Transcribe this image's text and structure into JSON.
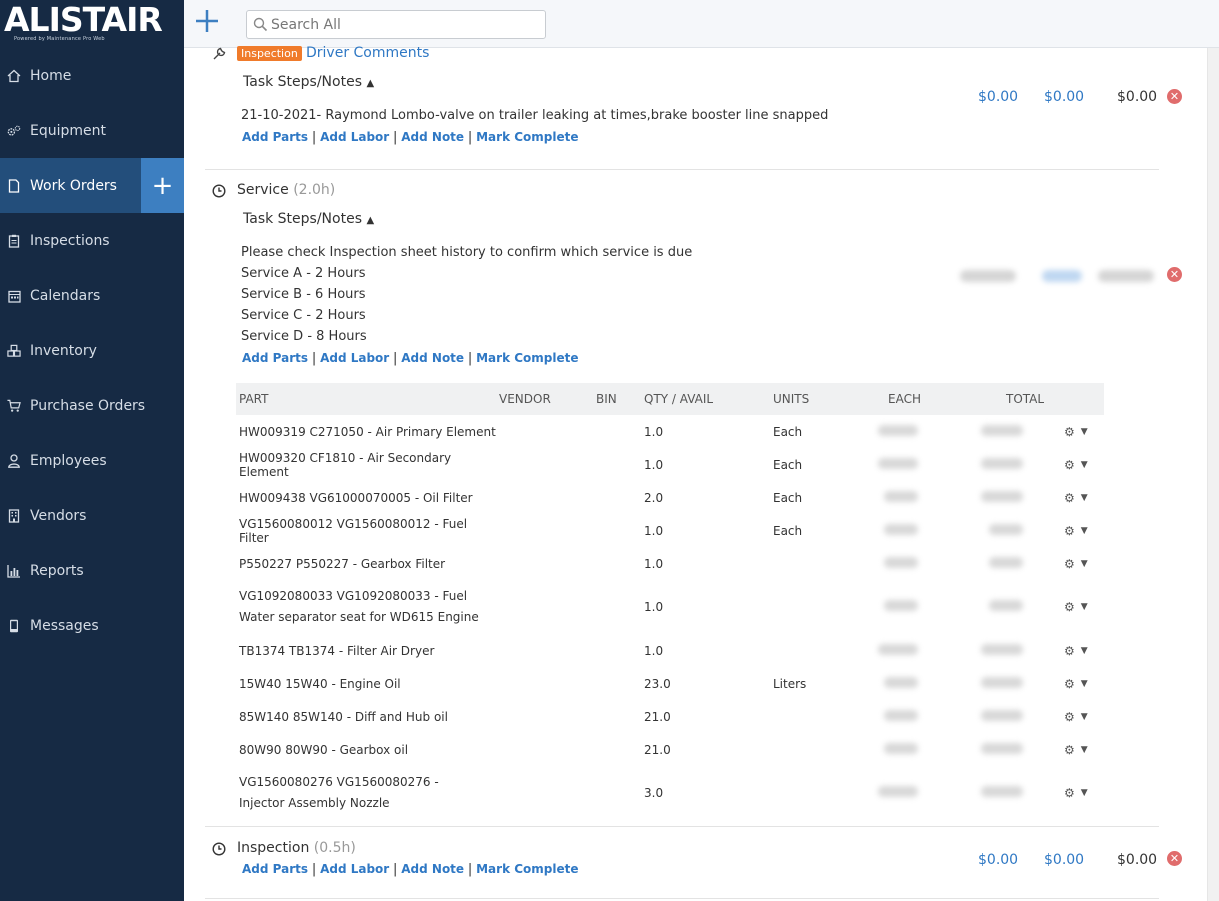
{
  "brand": {
    "logo_text": "ALISTAIR",
    "logo_sub": "Powered by Maintenance Pro Web"
  },
  "topbar": {
    "search_placeholder": "Search All"
  },
  "sidebar": {
    "items": [
      {
        "label": "Home",
        "icon": "home-icon"
      },
      {
        "label": "Equipment",
        "icon": "gears-icon"
      },
      {
        "label": "Work Orders",
        "icon": "document-icon",
        "active": true
      },
      {
        "label": "Inspections",
        "icon": "clipboard-icon"
      },
      {
        "label": "Calendars",
        "icon": "calendar-icon"
      },
      {
        "label": "Inventory",
        "icon": "cubes-icon"
      },
      {
        "label": "Purchase Orders",
        "icon": "cart-icon"
      },
      {
        "label": "Employees",
        "icon": "user-icon"
      },
      {
        "label": "Vendors",
        "icon": "building-icon"
      },
      {
        "label": "Reports",
        "icon": "chart-icon"
      },
      {
        "label": "Messages",
        "icon": "phone-icon"
      }
    ]
  },
  "actions": {
    "add_parts": "Add Parts",
    "add_labor": "Add Labor",
    "add_note": "Add Note",
    "mark_complete": "Mark Complete",
    "separator": "|"
  },
  "task_steps_label": "Task Steps/Notes",
  "task1": {
    "badge": "Inspection",
    "title": "Driver Comments",
    "note": "21-10-2021- Raymond Lombo-valve on trailer leaking at times,brake booster line snapped",
    "amount_parts": "$0.00",
    "amount_labor": "$0.00",
    "amount_total": "$0.00"
  },
  "task2": {
    "title": "Service",
    "hours": "(2.0h)",
    "notes": [
      "Please check Inspection sheet history to confirm which service is due",
      "Service A - 2 Hours",
      "Service B - 6 Hours",
      "Service C - 2 Hours",
      "Service D - 8 Hours"
    ]
  },
  "parts_table": {
    "headers": [
      "PART",
      "VENDOR",
      "BIN",
      "QTY / AVAIL",
      "UNITS",
      "EACH",
      "TOTAL"
    ],
    "rows": [
      {
        "part": "HW009319 C271050 - Air Primary Element",
        "qty": "1.0",
        "units": "Each"
      },
      {
        "part": "HW009320 CF1810 - Air Secondary Element",
        "qty": "1.0",
        "units": "Each"
      },
      {
        "part": "HW009438 VG61000070005 - Oil Filter",
        "qty": "2.0",
        "units": "Each"
      },
      {
        "part": "VG1560080012 VG1560080012 - Fuel Filter",
        "qty": "1.0",
        "units": "Each"
      },
      {
        "part": "P550227 P550227 - Gearbox Filter",
        "qty": "1.0",
        "units": ""
      },
      {
        "part": "VG1092080033 VG1092080033 - Fuel Water separator seat for WD615 Engine",
        "qty": "1.0",
        "units": ""
      },
      {
        "part": "TB1374 TB1374 - Filter Air Dryer",
        "qty": "1.0",
        "units": ""
      },
      {
        "part": "15W40 15W40 - Engine Oil",
        "qty": "23.0",
        "units": "Liters"
      },
      {
        "part": "85W140 85W140 - Diff and Hub oil",
        "qty": "21.0",
        "units": ""
      },
      {
        "part": "80W90 80W90 - Gearbox oil",
        "qty": "21.0",
        "units": ""
      },
      {
        "part": "VG1560080276 VG1560080276 - Injector Assembly Nozzle",
        "qty": "3.0",
        "units": ""
      }
    ]
  },
  "task3": {
    "title": "Inspection",
    "hours": "(0.5h)",
    "amount_parts": "$0.00",
    "amount_labor": "$0.00",
    "amount_total": "$0.00"
  }
}
